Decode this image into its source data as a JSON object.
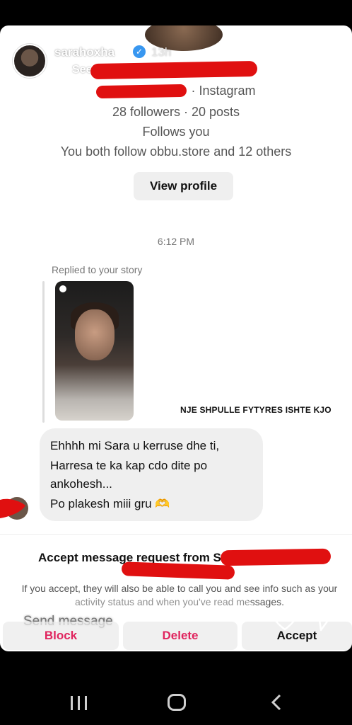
{
  "story": {
    "username": "sarahoxha",
    "time_ago": "13h",
    "see_translation": "See translation"
  },
  "profile_card": {
    "source": "· Instagram",
    "followers_posts": "28 followers · 20 posts",
    "follows_you": "Follows you",
    "mutuals": "You both follow obbu.store and 12 others",
    "view_profile": "View profile"
  },
  "thread": {
    "timestamp": "6:12 PM",
    "replied_label": "Replied to your story",
    "story_caption": "NJE SHPULLE FYTYRES ISHTE KJO",
    "message_lines": [
      "Ehhhh mi Sara u kerruse dhe ti,",
      "Harresa te ka kap cdo dite po",
      "ankohesh...",
      "Po plakesh miii gru 🫶"
    ]
  },
  "request": {
    "title": "Accept message request from S",
    "info": "If you accept, they will also be able to call you and see info such as your activity status and when you've read messages.",
    "block": "Block",
    "delete": "Delete",
    "accept": "Accept"
  },
  "reply_bar": {
    "placeholder": "Send message"
  },
  "colors": {
    "redaction": "#e01010",
    "danger": "#e0245e",
    "verified": "#3897f0"
  },
  "icons": [
    "verified-badge-icon",
    "more-icon",
    "heart-icon",
    "send-icon",
    "recents-icon",
    "home-icon",
    "back-icon"
  ]
}
